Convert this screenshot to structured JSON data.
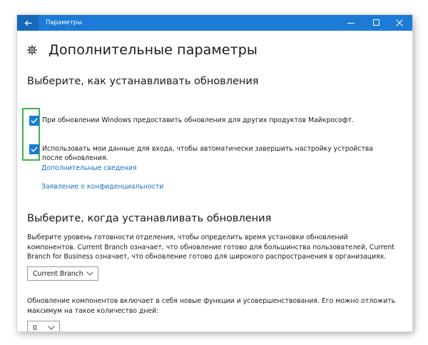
{
  "window": {
    "title": "Параметры"
  },
  "page": {
    "title": "Дополнительные параметры"
  },
  "section_install": {
    "title": "Выберите, как устанавливать обновления",
    "checkbox_other_products": {
      "label": "При обновлении Windows предоставить обновления для других продуктов Майкрософт.",
      "checked": true
    },
    "checkbox_signin": {
      "label": "Использовать мои данные для входа, чтобы автоматически завершить настройку устройства после обновления.",
      "checked": true
    },
    "link_more_info": "Дополнительные сведения",
    "link_privacy": "Заявление о конфиденциальности"
  },
  "section_when": {
    "title": "Выберите, когда устанавливать обновления",
    "readiness_description": "Выберите уровень готовности отделения, чтобы определить время установки обновлений компонентов. Current Branch означает, что обновление готово для большинства пользователей, Current Branch for Business означает, что обновление готово для широкого распространения в организациях.",
    "branch_select_value": "Current Branch",
    "feature_defer_description": "Обновление компонентов включает в себя новые функции и усовершенствования. Его можно отложить максимум на такое количество дней:",
    "defer_days_value": "0"
  },
  "colors": {
    "accent": "#1b7bd5",
    "highlight": "#3ab54a",
    "link": "#1b6ec2"
  },
  "icons": {
    "back": "back-arrow-icon",
    "minimize": "minimize-icon",
    "maximize": "maximize-icon",
    "close": "close-icon",
    "settings": "gear-icon",
    "dropdown": "chevron-down-icon",
    "checkmark": "checkmark-icon"
  }
}
